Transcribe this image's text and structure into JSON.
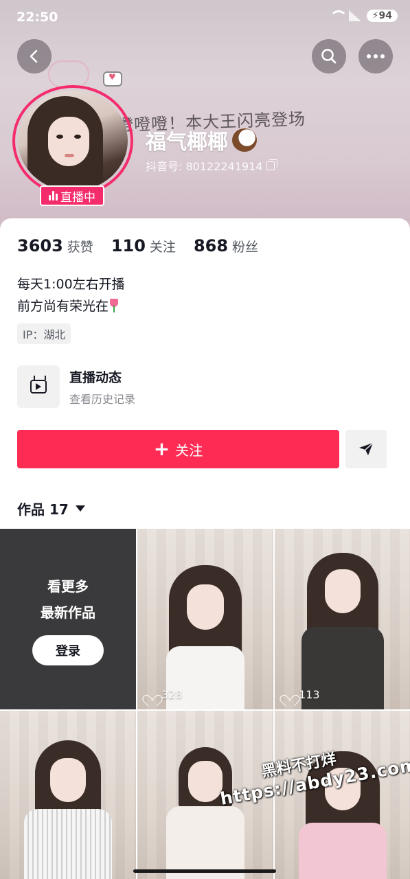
{
  "status_bar": {
    "time": "22:50",
    "battery": "94"
  },
  "header": {
    "back_icon": "chevron-left-icon",
    "search_icon": "search-icon",
    "more_icon": "more-dots-icon",
    "banner_doodle": "噔噔噔！本大王闪亮登场",
    "live_badge": "直播中",
    "nickname": "福气椰椰",
    "douyin_id": "抖音号: 80122241914"
  },
  "stats": [
    {
      "value": "3603",
      "label": "获赞"
    },
    {
      "value": "110",
      "label": "关注"
    },
    {
      "value": "868",
      "label": "粉丝"
    }
  ],
  "bio": {
    "line1": "每天1:00左右开播",
    "line2": "前方尚有荣光在"
  },
  "ip": "IP：湖北",
  "live_dynamic": {
    "title": "直播动态",
    "subtitle": "查看历史记录"
  },
  "actions": {
    "follow_label": "关注",
    "share_icon": "paper-plane-icon"
  },
  "works": {
    "tab_label": "作品 17"
  },
  "promo": {
    "line1": "看更多",
    "line2": "最新作品",
    "login_label": "登录"
  },
  "videos": [
    {
      "likes": "328"
    },
    {
      "likes": "113"
    }
  ],
  "watermark": {
    "line1": "黑料不打烊",
    "line2": "https://abdy23.com"
  },
  "colors": {
    "accent": "#fe2c55",
    "live_pink": "#f52c6b",
    "text": "#161823",
    "muted": "#555a62"
  }
}
